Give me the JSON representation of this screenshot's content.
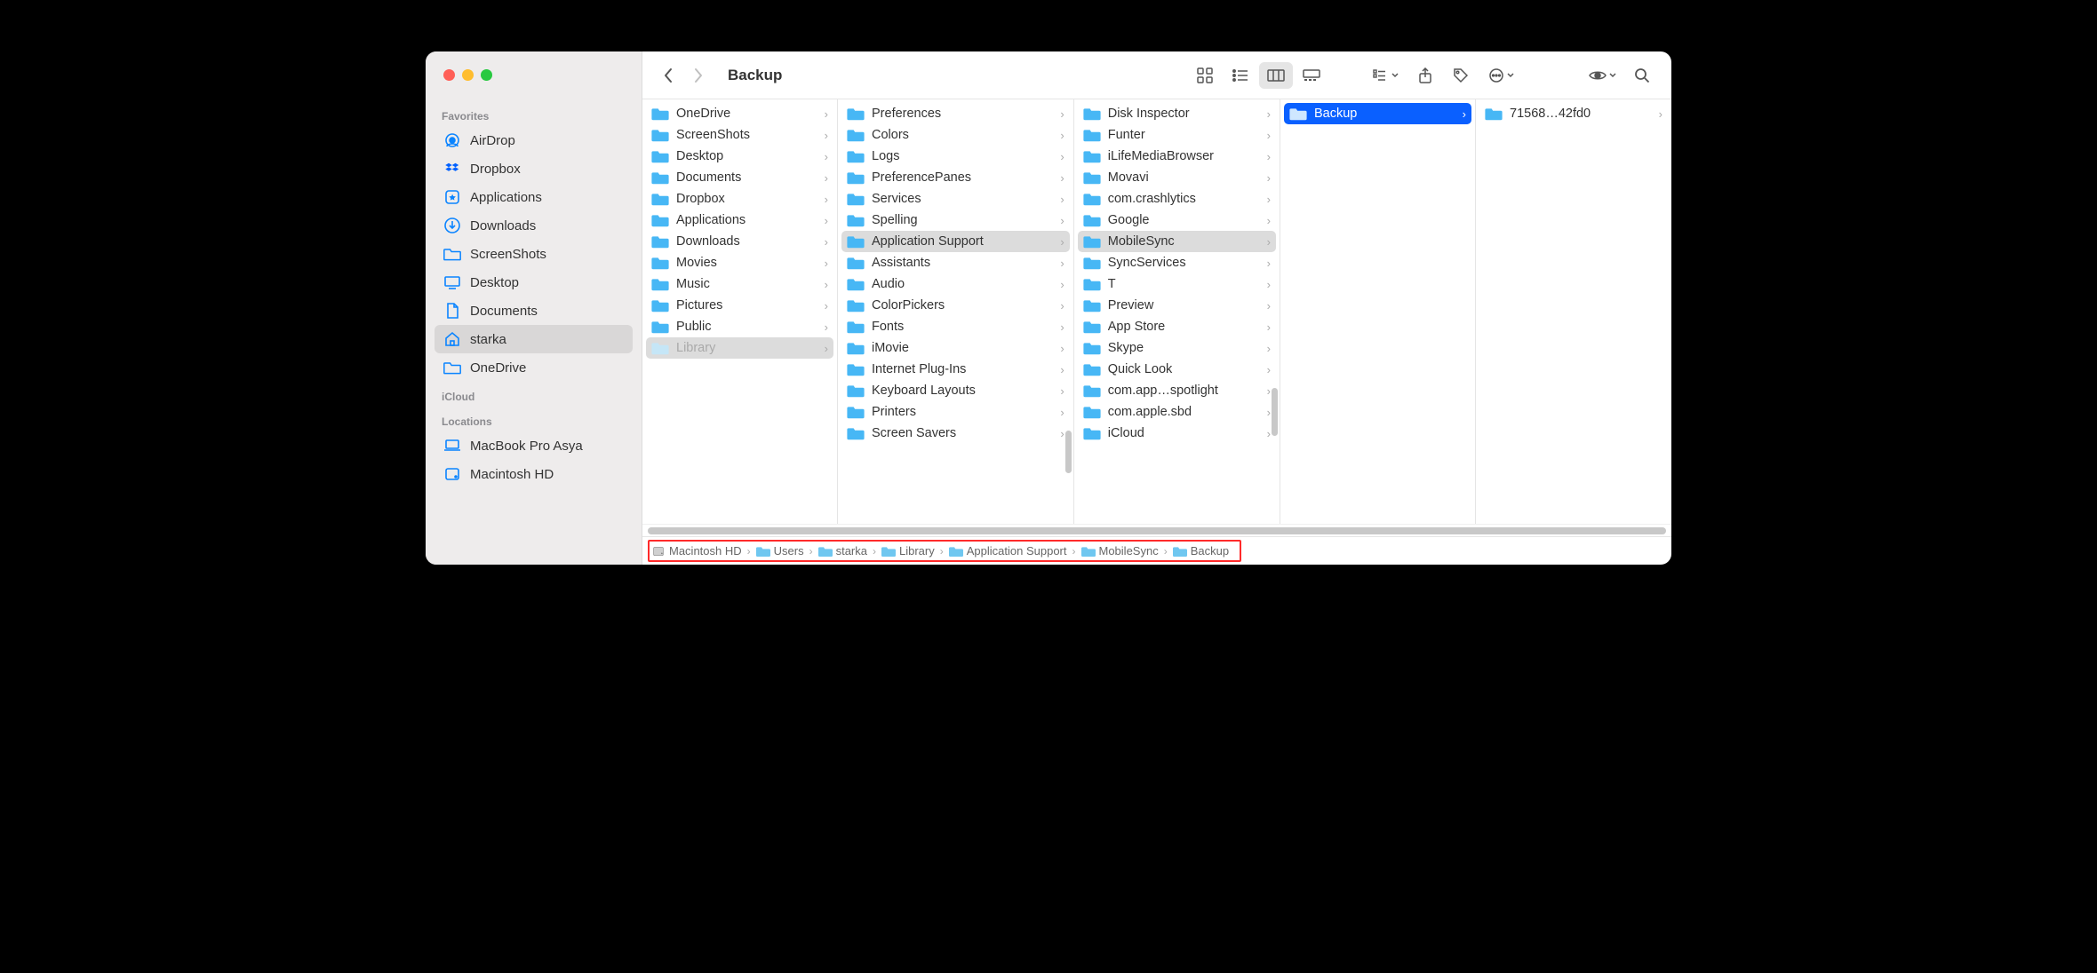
{
  "title": "Backup",
  "sidebar": {
    "sections": [
      {
        "header": "Favorites",
        "items": [
          {
            "icon": "airdrop",
            "label": "AirDrop"
          },
          {
            "icon": "dropbox",
            "label": "Dropbox"
          },
          {
            "icon": "applications",
            "label": "Applications"
          },
          {
            "icon": "downloads",
            "label": "Downloads"
          },
          {
            "icon": "folder",
            "label": "ScreenShots"
          },
          {
            "icon": "desktop",
            "label": "Desktop"
          },
          {
            "icon": "documents",
            "label": "Documents"
          },
          {
            "icon": "home",
            "label": "starka",
            "selected": true
          },
          {
            "icon": "folder",
            "label": "OneDrive"
          }
        ]
      },
      {
        "header": "iCloud",
        "items": []
      },
      {
        "header": "Locations",
        "items": [
          {
            "icon": "laptop",
            "label": "MacBook Pro Asya"
          },
          {
            "icon": "hdd",
            "label": "Macintosh HD"
          }
        ]
      }
    ]
  },
  "columns": [
    {
      "items": [
        {
          "label": "OneDrive"
        },
        {
          "label": "ScreenShots"
        },
        {
          "label": "Desktop"
        },
        {
          "label": "Documents"
        },
        {
          "label": "Dropbox"
        },
        {
          "label": "Applications"
        },
        {
          "label": "Downloads"
        },
        {
          "label": "Movies"
        },
        {
          "label": "Music"
        },
        {
          "label": "Pictures"
        },
        {
          "label": "Public"
        },
        {
          "label": "Library",
          "selected": true,
          "dimmed": true
        }
      ]
    },
    {
      "items": [
        {
          "label": "Preferences"
        },
        {
          "label": "Colors"
        },
        {
          "label": "Logs"
        },
        {
          "label": "PreferencePanes"
        },
        {
          "label": "Services"
        },
        {
          "label": "Spelling"
        },
        {
          "label": "Application Support",
          "selected": true
        },
        {
          "label": "Assistants"
        },
        {
          "label": "Audio"
        },
        {
          "label": "ColorPickers"
        },
        {
          "label": "Fonts"
        },
        {
          "label": "iMovie"
        },
        {
          "label": "Internet Plug-Ins"
        },
        {
          "label": "Keyboard Layouts"
        },
        {
          "label": "Printers"
        },
        {
          "label": "Screen Savers"
        }
      ]
    },
    {
      "items": [
        {
          "label": "Disk Inspector"
        },
        {
          "label": "Funter"
        },
        {
          "label": "iLifeMediaBrowser"
        },
        {
          "label": "Movavi"
        },
        {
          "label": "com.crashlytics"
        },
        {
          "label": "Google"
        },
        {
          "label": "MobileSync",
          "selected": true
        },
        {
          "label": "SyncServices"
        },
        {
          "label": "T"
        },
        {
          "label": "Preview"
        },
        {
          "label": "App Store"
        },
        {
          "label": "Skype"
        },
        {
          "label": "Quick Look"
        },
        {
          "label": "com.app…spotlight"
        },
        {
          "label": "com.apple.sbd"
        },
        {
          "label": "iCloud"
        }
      ]
    },
    {
      "items": [
        {
          "label": "Backup",
          "active": true
        }
      ]
    },
    {
      "items": [
        {
          "label": "71568…42fd0"
        }
      ]
    }
  ],
  "pathbar": [
    {
      "icon": "hdd",
      "label": "Macintosh HD"
    },
    {
      "icon": "folder",
      "label": "Users"
    },
    {
      "icon": "folder",
      "label": "starka"
    },
    {
      "icon": "folder",
      "label": "Library"
    },
    {
      "icon": "folder",
      "label": "Application Support"
    },
    {
      "icon": "folder",
      "label": "MobileSync"
    },
    {
      "icon": "folder",
      "label": "Backup"
    }
  ]
}
